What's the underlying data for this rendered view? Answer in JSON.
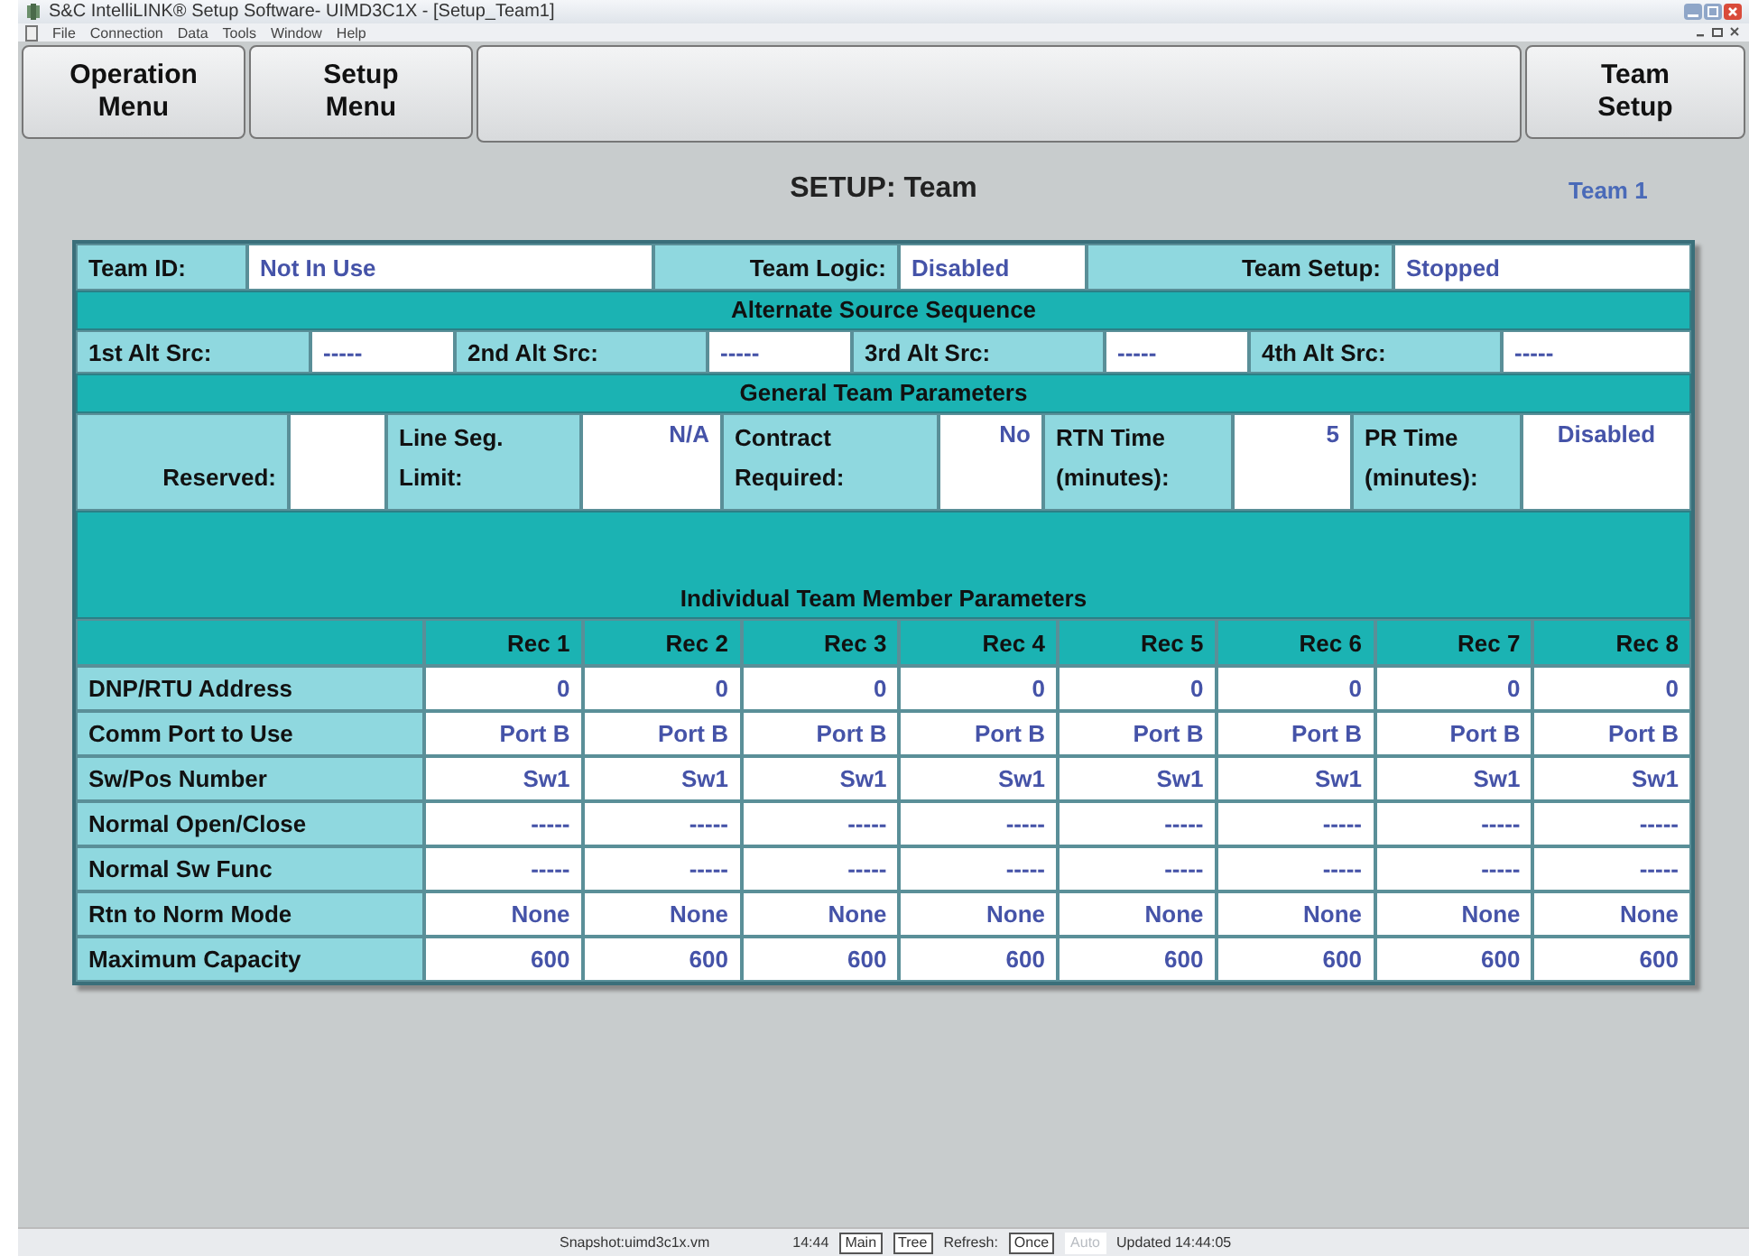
{
  "window": {
    "title": "S&C IntelliLINK® Setup Software- UIMD3C1X - [Setup_Team1]"
  },
  "menu": [
    "File",
    "Connection",
    "Data",
    "Tools",
    "Window",
    "Help"
  ],
  "toolbar": [
    {
      "kind": "button",
      "lines": [
        "Operation",
        "Menu"
      ]
    },
    {
      "kind": "button",
      "lines": [
        "Setup",
        "Menu"
      ]
    },
    {
      "kind": "spacer"
    },
    {
      "kind": "button",
      "lines": [
        "Team",
        "Setup"
      ]
    }
  ],
  "page": {
    "title": "SETUP: Team",
    "team": "Team 1"
  },
  "team_row": [
    {
      "label": "Team ID:",
      "value": "Not In Use"
    },
    {
      "label": "Team Logic:",
      "value": "Disabled"
    },
    {
      "label": "Team Setup:",
      "value": "Stopped"
    }
  ],
  "alt_title": "Alternate Source Sequence",
  "alt_sources": [
    {
      "label": "1st Alt Src:",
      "value": "-----"
    },
    {
      "label": "2nd Alt Src:",
      "value": "-----"
    },
    {
      "label": "3rd Alt Src:",
      "value": "-----"
    },
    {
      "label": "4th Alt Src:",
      "value": "-----"
    }
  ],
  "general_title": "General Team Parameters",
  "general": [
    {
      "label": [
        "Reserved:"
      ]
    },
    {
      "label": [
        "Line Seg.",
        "Limit:"
      ],
      "value": "N/A"
    },
    {
      "label": [
        "Contract",
        "Required:"
      ],
      "value": "No"
    },
    {
      "label": [
        "RTN Time",
        "(minutes):"
      ],
      "value": "5"
    },
    {
      "label": [
        "PR Time",
        "(minutes):"
      ],
      "value": "Disabled"
    }
  ],
  "members_title": "Individual Team Member Parameters",
  "columns": [
    "Rec 1",
    "Rec 2",
    "Rec 3",
    "Rec 4",
    "Rec 5",
    "Rec 6",
    "Rec 7",
    "Rec 8"
  ],
  "rows": [
    {
      "label": "DNP/RTU Address",
      "values": [
        "0",
        "0",
        "0",
        "0",
        "0",
        "0",
        "0",
        "0"
      ]
    },
    {
      "label": "Comm Port to Use",
      "values": [
        "Port B",
        "Port B",
        "Port B",
        "Port B",
        "Port B",
        "Port B",
        "Port B",
        "Port B"
      ]
    },
    {
      "label": "Sw/Pos Number",
      "values": [
        "Sw1",
        "Sw1",
        "Sw1",
        "Sw1",
        "Sw1",
        "Sw1",
        "Sw1",
        "Sw1"
      ]
    },
    {
      "label": "Normal Open/Close",
      "values": [
        "-----",
        "-----",
        "-----",
        "-----",
        "-----",
        "-----",
        "-----",
        "-----"
      ]
    },
    {
      "label": "Normal Sw Func",
      "values": [
        "-----",
        "-----",
        "-----",
        "-----",
        "-----",
        "-----",
        "-----",
        "-----"
      ]
    },
    {
      "label": "Rtn to Norm Mode",
      "values": [
        "None",
        "None",
        "None",
        "None",
        "None",
        "None",
        "None",
        "None"
      ]
    },
    {
      "label": "Maximum Capacity",
      "values": [
        "600",
        "600",
        "600",
        "600",
        "600",
        "600",
        "600",
        "600"
      ]
    }
  ],
  "status": {
    "snapshot": "Snapshot:uimd3c1x.vm",
    "time": "14:44",
    "buttons": [
      {
        "label": "Main",
        "disabled": false
      },
      {
        "label": "Tree",
        "disabled": false
      }
    ],
    "refresh": "Refresh:",
    "modes": [
      {
        "label": "Once",
        "disabled": false
      },
      {
        "label": "Auto",
        "disabled": true
      }
    ],
    "updated": "Updated 14:44:05"
  }
}
